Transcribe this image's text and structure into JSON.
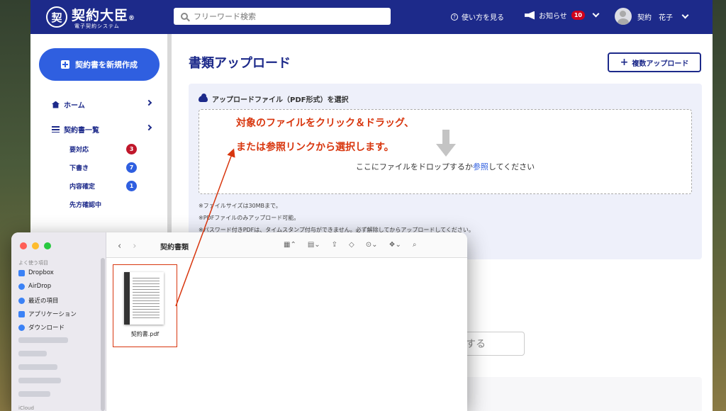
{
  "topbar": {
    "logo_mark": "契",
    "logo_title": "契約大臣",
    "logo_registered": "®",
    "logo_sub": "電子契約システム",
    "search_placeholder": "フリーワード検索",
    "help_label": "使い方を見る",
    "notice_label": "お知らせ",
    "notice_count": "10",
    "user_name": "契約　花子"
  },
  "sidebar": {
    "new_button": "契約書を新規作成",
    "home": "ホーム",
    "contracts": "契約書一覧",
    "subitems": [
      {
        "label": "要対応",
        "count": "3",
        "color": "#c0172b"
      },
      {
        "label": "下書き",
        "count": "7",
        "color": "#2f5fe0"
      },
      {
        "label": "内容確定",
        "count": "1",
        "color": "#2f5fe0"
      },
      {
        "label": "先方確認中",
        "count": ""
      }
    ]
  },
  "main": {
    "title": "書類アップロード",
    "multi_upload": "複数アップロード",
    "upload_header": "アップロードファイル（PDF形式）を選択",
    "drop_text_pre": "ここにファイルをドロップするか",
    "drop_text_link": "参照",
    "drop_text_post": "してください",
    "callout_line1": "対象のファイルをクリック＆ドラッグ、",
    "callout_line2": "または参照リンクから選択します。",
    "notes": [
      "※ファイルサイズは30MBまで。",
      "※PDFファイルのみアップロード可能。",
      "※パスワード付きPDFは、タイムスタンプ付与ができません。必ず解除してからアップロードしてください。"
    ],
    "bottom_button": "する"
  },
  "finder": {
    "section": "よく使う項目",
    "items": [
      "Dropbox",
      "AirDrop",
      "最近の項目",
      "アプリケーション",
      "ダウンロード"
    ],
    "icloud": "iCloud",
    "title": "契約書類",
    "file_name": "契約書.pdf"
  },
  "colors": {
    "brand": "#1d2a8a",
    "accent": "#2f5fe0",
    "callout": "#d8360e"
  }
}
